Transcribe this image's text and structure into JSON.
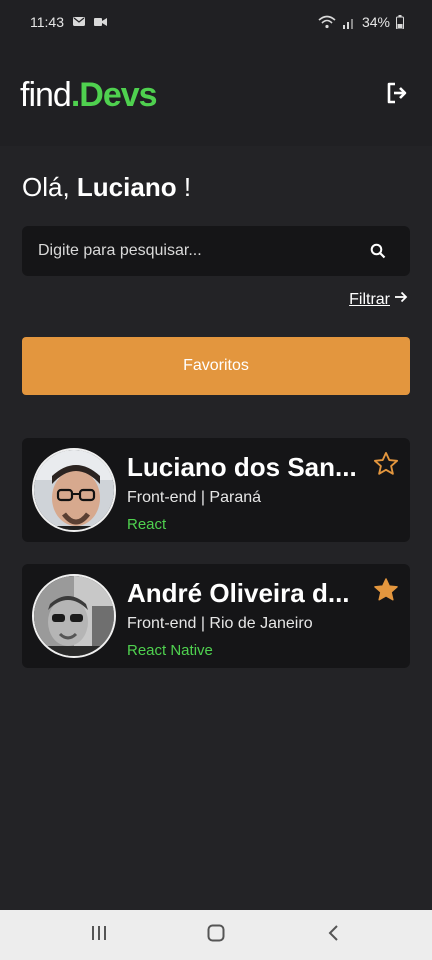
{
  "status_bar": {
    "time": "11:43",
    "battery": "34%"
  },
  "header": {
    "logo_find": "find",
    "logo_dot": ".",
    "logo_devs": "Devs"
  },
  "greeting": {
    "prefix": "Olá,",
    "name": "Luciano",
    "suffix": "!"
  },
  "search": {
    "placeholder": "Digite para pesquisar..."
  },
  "filter": {
    "label": "Filtrar"
  },
  "favorites_button": {
    "label": "Favoritos"
  },
  "devs": [
    {
      "name": "Luciano dos San...",
      "role": "Front-end | Paraná",
      "tech": "React",
      "favorite": false
    },
    {
      "name": "André Oliveira d...",
      "role": "Front-end | Rio de Janeiro",
      "tech": "React Native",
      "favorite": true
    }
  ],
  "colors": {
    "background": "#232326",
    "header": "#202023",
    "card": "#151517",
    "accent_green": "#4fd14f",
    "accent_orange": "#e3963e"
  }
}
